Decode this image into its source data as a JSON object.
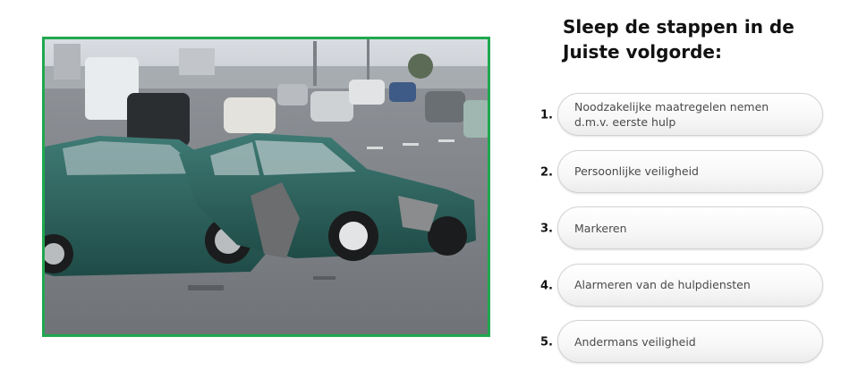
{
  "exercise": {
    "title": "Sleep de stappen in de Juiste volgorde:",
    "image": {
      "alt": "car-crash-photo",
      "frame_color": "#1fa84f"
    },
    "steps": [
      {
        "number": "1.",
        "label": "Noodzakelijke maatregelen nemen d.m.v. eerste hulp"
      },
      {
        "number": "2.",
        "label": "Persoonlijke veiligheid"
      },
      {
        "number": "3.",
        "label": "Markeren"
      },
      {
        "number": "4.",
        "label": "Alarmeren van de hulpdiensten"
      },
      {
        "number": "5.",
        "label": "Andermans veiligheid"
      }
    ]
  }
}
